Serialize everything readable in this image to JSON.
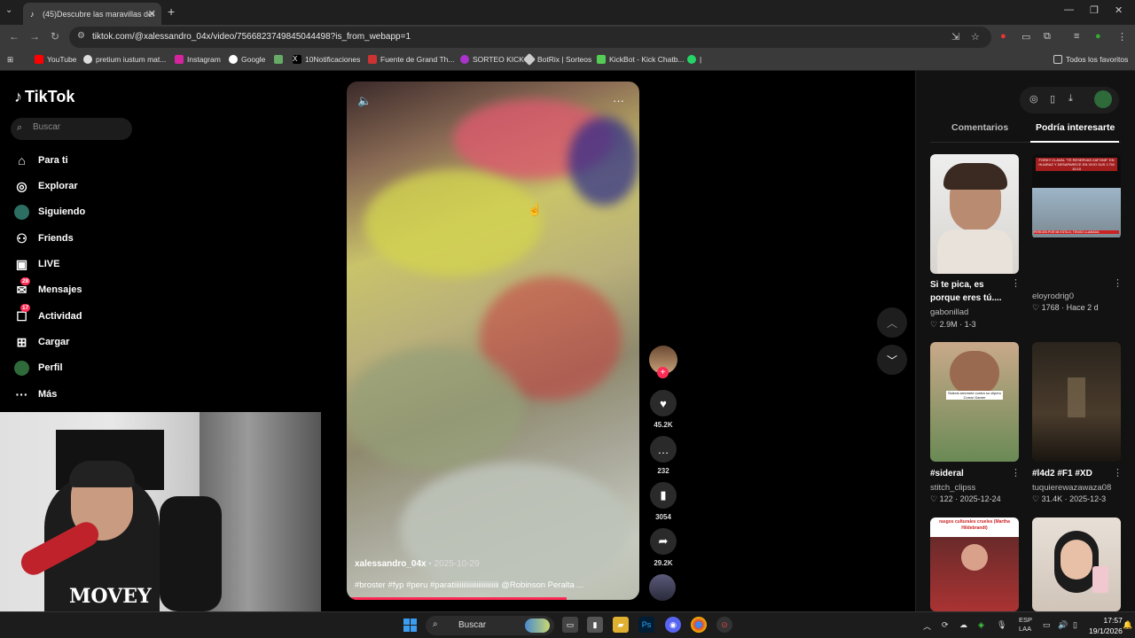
{
  "browser": {
    "tab_title": "(45)Descubre las maravillas del",
    "url": "tiktok.com/@xalessandro_04x/video/7566823749845044498?is_from_webapp=1",
    "bookmarks": [
      "YouTube",
      "pretium iustum mat...",
      "Instagram",
      "Google",
      "10Notificaciones",
      "Fuente de Grand Th...",
      "SORTEO KICK",
      "BotRix | Sorteos",
      "KickBot - Kick Chatb..."
    ],
    "all_bookmarks": "Todos los favoritos"
  },
  "tiktok": {
    "logo": "TikTok",
    "search_placeholder": "Buscar",
    "nav": [
      {
        "label": "Para ti",
        "icon": "home-icon"
      },
      {
        "label": "Explorar",
        "icon": "compass-icon"
      },
      {
        "label": "Siguiendo",
        "icon": "following-icon"
      },
      {
        "label": "Friends",
        "icon": "friends-icon"
      },
      {
        "label": "LIVE",
        "icon": "live-icon"
      },
      {
        "label": "Mensajes",
        "icon": "messages-icon",
        "badge": "28"
      },
      {
        "label": "Actividad",
        "icon": "activity-icon",
        "badge": "17"
      },
      {
        "label": "Cargar",
        "icon": "upload-icon"
      },
      {
        "label": "Perfil",
        "icon": "profile-icon"
      },
      {
        "label": "Más",
        "icon": "more-icon"
      }
    ]
  },
  "webcam": {
    "shirt_text": "MOVEY"
  },
  "video": {
    "author": "xalessandro_04x",
    "date": "2025-10-29",
    "caption": "#broster #fyp #peru #paratiiiiiiiiiiiiiiiiiiiiiiii @Robinson Peralta ...",
    "progress_fraction": 0.75,
    "likes": "45.2K",
    "comments": "232",
    "saves": "3054",
    "shares": "29.2K"
  },
  "right_panel": {
    "tabs": [
      "Comentarios",
      "Podría interesarte"
    ],
    "cards": [
      {
        "title": "Si te pica, es porque eres tú....",
        "user": "gabonillad",
        "stats": "♡ 2.9M · 1-3"
      },
      {
        "title": "",
        "user": "eloyrodrig0",
        "stats": "♡ 1768 · Hace 2 d",
        "thumb_caption": "FORKY CLAVAL \"TE RESERVAS ZAFONE\" EN HUARAZ Y DESAPARECE EN VIVO SUS 1:TM 10:10",
        "thumb_caption2": "PERDÓN POR MI ESTILO, TENGO LLAMADA"
      },
      {
        "title": "#sideral",
        "user": "stitch_clipss",
        "stats": "♡ 122 · 2025-12-24",
        "thumb_caption": "Sideral arremete contra su clipero Corrar Gamer"
      },
      {
        "title": "#l4d2 #F1 #XD",
        "user": "tuquierewazawaza08",
        "stats": "♡ 31.4K · 2025-12-3"
      },
      {
        "title": "",
        "user": "",
        "stats": "",
        "thumb_caption": "rasgos culturales crueles (Martha Hildebrandt)"
      },
      {
        "title": "",
        "user": "",
        "stats": ""
      }
    ]
  },
  "taskbar": {
    "search": "Buscar",
    "lang": "ESP",
    "lang2": "LAA",
    "time": "17:57",
    "date": "19/1/2026"
  }
}
